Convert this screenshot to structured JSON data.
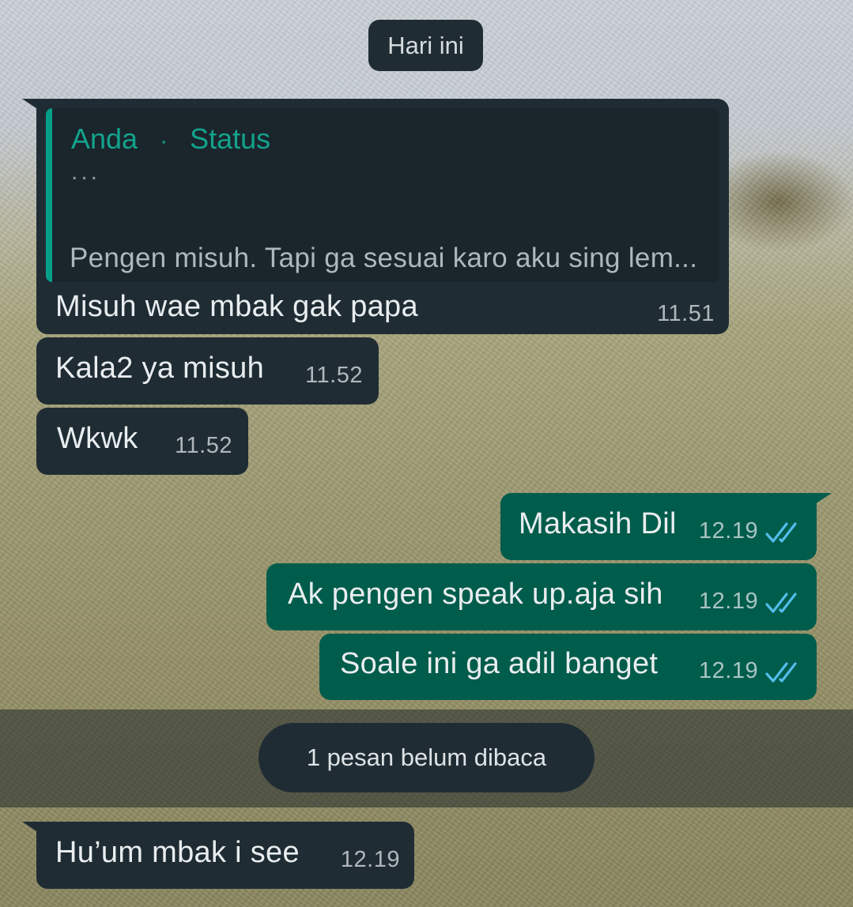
{
  "date_separator": "Hari ini",
  "status_reply": {
    "author": "Anda",
    "separator": "·",
    "label": "Status",
    "dots": "...",
    "quoted_text": "Pengen misuh. Tapi ga sesuai karo aku sing lem...",
    "text": "Misuh wae mbak gak papa",
    "time": "11.51"
  },
  "messages": [
    {
      "text": "Kala2 ya misuh",
      "time": "11.52",
      "direction": "incoming"
    },
    {
      "text": "Wkwk",
      "time": "11.52",
      "direction": "incoming"
    },
    {
      "text": "Makasih Dil",
      "time": "12.19",
      "direction": "outgoing",
      "status": "read"
    },
    {
      "text": "Ak pengen speak up.aja sih",
      "time": "12.19",
      "direction": "outgoing",
      "status": "read"
    },
    {
      "text": "Soale ini ga adil banget",
      "time": "12.19",
      "direction": "outgoing",
      "status": "read"
    }
  ],
  "unread_label": "1 pesan belum dibaca",
  "last_message": {
    "text": "Hu’um mbak i see",
    "time": "12.19",
    "direction": "incoming"
  },
  "colors": {
    "incoming_bubble": "#1f2c34",
    "outgoing_bubble": "#005c4b",
    "read_ticks": "#53bdeb",
    "quote_accent": "#06a089"
  }
}
